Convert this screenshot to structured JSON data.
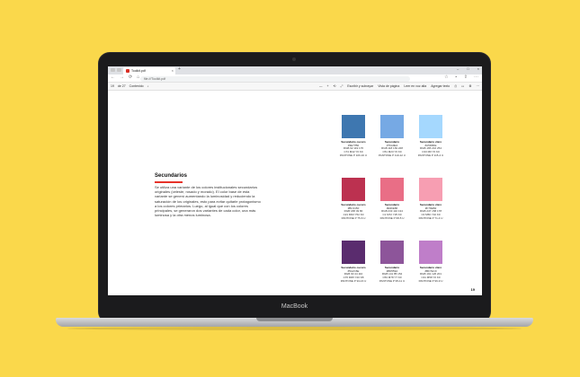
{
  "laptop": {
    "brand": "MacBook"
  },
  "tab": {
    "title": "Toolkit.pdf",
    "close": "×",
    "new": "+"
  },
  "window": {
    "min": "–",
    "max": "□",
    "close": "×"
  },
  "nav": {
    "back": "←",
    "forward": "→",
    "refresh": "⟳",
    "home": "⌂"
  },
  "address": {
    "url": "file:///Toolkit.pdf"
  },
  "addr_icons": {
    "star": "☆",
    "favs": "⋆",
    "share": "⇪",
    "more": "⋯"
  },
  "pdf_toolbar": {
    "page": "19",
    "of_total": "de 27",
    "contents": "Contenido",
    "search": "⌕",
    "zoom_out": "—",
    "zoom_in": "+",
    "rotate": "⟲",
    "fit": "⤢",
    "read_aloud": "Escribir y subrayar",
    "page_view": "Vista de página",
    "text_size": "Leer en voz alta",
    "add_text": "Agregar texto",
    "print": "⎙",
    "save": "▭",
    "pin": "⚙",
    "more": "⋯"
  },
  "document": {
    "section_title": "Secundarios",
    "paragraph": "Se utiliza una variante de los colores institucionales secundarios originales (celeste, rosado y morado). El color base de esta variante se generó aumentando la luminosidad y reduciendo la saturación de los originales, esto para evitar quitarle protagonismo a los colores primarios. Luego, al igual que con los colores principales, se generaron dos variantes de cada color, una más luminosa y la otra menos luminosa.",
    "page_number": "19"
  },
  "swatches": [
    {
      "hex_color": "#3E77B0",
      "name": "Secundario oscuro",
      "lines": [
        "#3E77B0",
        "RGB 62 119 176",
        "C74 M42 Y0 K0",
        "PANTONE P 106-16 U"
      ]
    },
    {
      "hex_color": "#76A9E4",
      "name": "Secundario",
      "lines": [
        "#76A9E4",
        "RGB 118 169 228",
        "C51 M23 Y0 K0",
        "PANTONE P 110-12 U"
      ]
    },
    {
      "hex_color": "#A5D8FE",
      "name": "Secundario claro",
      "lines": [
        "#A5D8FE",
        "RGB 165 216 254",
        "C33 M0 Y0 K0",
        "PANTONE P 115-4 U"
      ]
    },
    {
      "hex_color": "#BC3150",
      "name": "Secundario oscuro",
      "lines": [
        "#BC3150",
        "RGB 188 49 80",
        "C21 M93 Y52 K0",
        "PANTONE P 75-6 U"
      ]
    },
    {
      "hex_color": "#E96E86",
      "name": "Secundario",
      "lines": [
        "#E96E86",
        "RGB 233 110 134",
        "C1 M72 Y25 K0",
        "PANTONE P 68-5 U"
      ]
    },
    {
      "hex_color": "#F79EB2",
      "name": "Secundario claro",
      "lines": [
        "#F79EB2",
        "RGB 247 158 178",
        "C0 M50 Y10 K0",
        "PANTONE P 71-4 U"
      ]
    },
    {
      "hex_color": "#5A2C6E",
      "name": "Secundario oscuro",
      "lines": [
        "#5A2C6E",
        "RGB 90 44 110",
        "C76 M95 Y20 K8",
        "PANTONE P 94-16 U"
      ]
    },
    {
      "hex_color": "#8D559A",
      "name": "Secundario",
      "lines": [
        "#8D559A",
        "RGB 141 85 154",
        "C53 M78 Y7 K0",
        "PANTONE P 95-11 U"
      ]
    },
    {
      "hex_color": "#BF7EC9",
      "name": "Secundario claro",
      "lines": [
        "#BF7EC9",
        "RGB 191 126 201",
        "C31 M58 Y0 K0",
        "PANTONE P 96-9 U"
      ]
    }
  ]
}
